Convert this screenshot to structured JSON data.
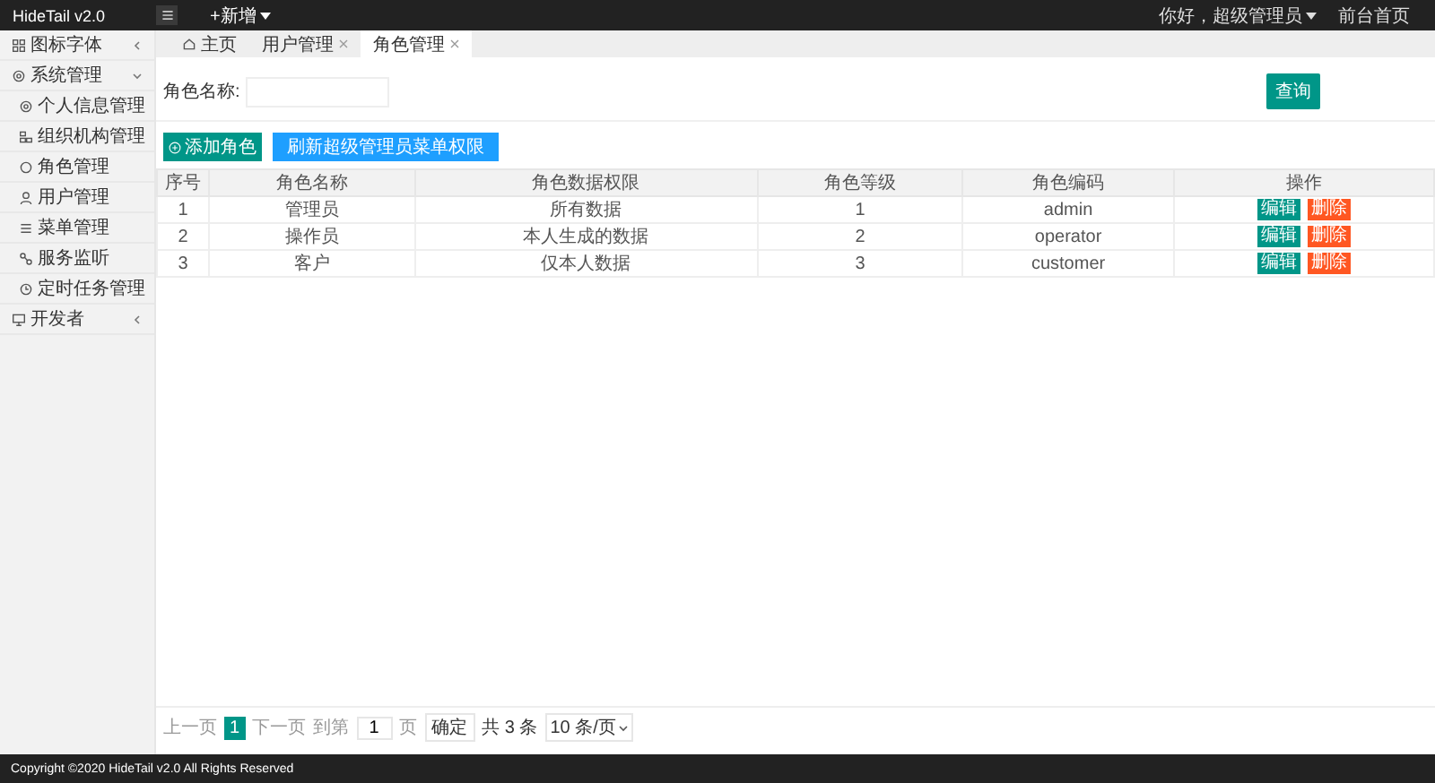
{
  "header": {
    "logo": "HideTail v2.0",
    "new_menu": "+新增",
    "user_menu": "你好，超级管理员",
    "home_link": "前台首页"
  },
  "sidebar": {
    "items": [
      {
        "label": "图标字体",
        "expanded": false
      },
      {
        "label": "系统管理",
        "expanded": true,
        "children": [
          {
            "label": "个人信息管理"
          },
          {
            "label": "组织机构管理"
          },
          {
            "label": "角色管理"
          },
          {
            "label": "用户管理"
          },
          {
            "label": "菜单管理"
          },
          {
            "label": "服务监听"
          },
          {
            "label": "定时任务管理"
          }
        ]
      },
      {
        "label": "开发者",
        "expanded": false
      }
    ]
  },
  "tabs": [
    {
      "label": "主页",
      "selected": false,
      "closable": false
    },
    {
      "label": "用户管理",
      "selected": false,
      "closable": true
    },
    {
      "label": "角色管理",
      "selected": true,
      "closable": true
    }
  ],
  "search": {
    "label": "角色名称:",
    "button": "查询"
  },
  "toolbar": [
    "添加角色",
    "刷新超级管理员菜单权限"
  ],
  "table": {
    "columns": [
      "序号",
      "角色名称",
      "角色数据权限",
      "角色等级",
      "角色编码",
      "操作"
    ],
    "rows": [
      {
        "cells": [
          "1",
          "管理员",
          "所有数据",
          "1",
          "admin"
        ],
        "actions": [
          "编辑",
          "删除"
        ]
      },
      {
        "cells": [
          "2",
          "操作员",
          "本人生成的数据",
          "2",
          "operator"
        ],
        "actions": [
          "编辑",
          "删除"
        ]
      },
      {
        "cells": [
          "3",
          "客户",
          "仅本人数据",
          "3",
          "customer"
        ],
        "actions": [
          "编辑",
          "删除"
        ]
      }
    ]
  },
  "pagination": {
    "prev": "上一页",
    "pages": [
      {
        "label": "1",
        "selected": true
      }
    ],
    "next": "下一页",
    "goto_label": "到第",
    "goto_value": "1",
    "page_unit": "页",
    "confirm": "确定",
    "total": "共 3 条",
    "page_size": "10 条/页"
  },
  "footer": "Copyright ©2020 HideTail v2.0 All Rights Reserved"
}
